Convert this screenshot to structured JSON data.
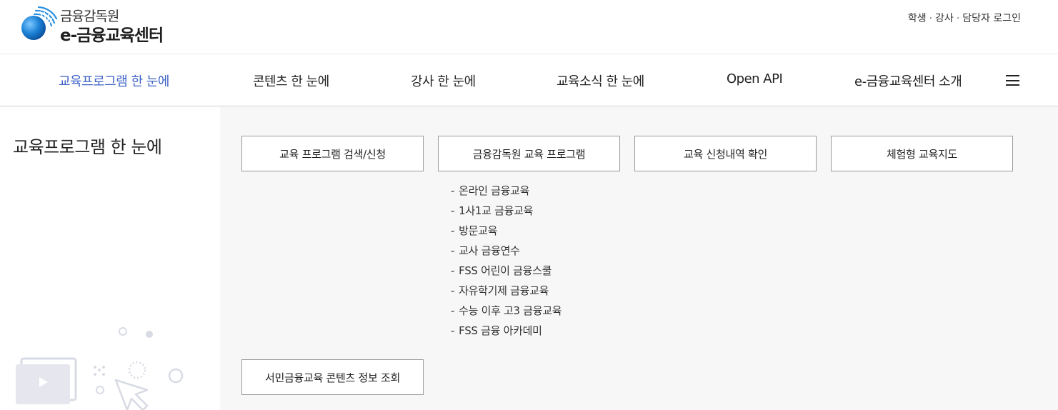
{
  "header": {
    "logo": {
      "org_name": "금융감독원",
      "center_name": "e-금융교육센터"
    },
    "login_links": [
      "학생",
      "강사",
      "담당자 로그인"
    ],
    "login_separator": "·"
  },
  "nav": {
    "items": [
      {
        "label": "교육프로그램 한 눈에",
        "active": true
      },
      {
        "label": "콘텐츠 한 눈에",
        "active": false
      },
      {
        "label": "강사 한 눈에",
        "active": false
      },
      {
        "label": "교육소식 한 눈에",
        "active": false
      },
      {
        "label": "Open API",
        "active": false
      },
      {
        "label": "e-금융교육센터 소개",
        "active": false
      }
    ],
    "menu_icon": "hamburger-icon"
  },
  "side": {
    "title": "교육프로그램 한 눈에"
  },
  "content": {
    "buttons": [
      {
        "label": "교육 프로그램 검색/신청"
      },
      {
        "label": "금융감독원 교육 프로그램"
      },
      {
        "label": "교육 신청내역 확인"
      },
      {
        "label": "체험형 교육지도"
      },
      {
        "label": "서민금융교육 콘텐츠 정보 조회"
      }
    ],
    "sub_menu_dash": "-",
    "sub_menu": [
      "온라인 금융교육",
      "1사1교 금융교육",
      "방문교육",
      "교사 금융연수",
      "FSS 어린이 금융스쿨",
      "자유학기제 금융교육",
      "수능 이후 고3 금융교육",
      "FSS 금융 아카데미"
    ]
  },
  "colors": {
    "accent": "#3f63c7",
    "content_bg": "#f7f7f7",
    "button_border": "#9a9a9a"
  }
}
